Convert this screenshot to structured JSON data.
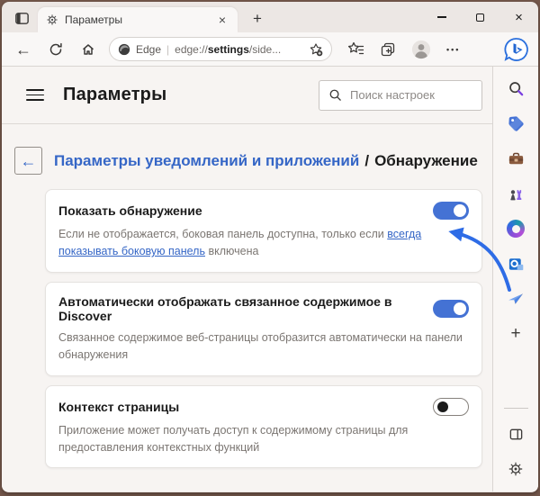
{
  "titlebar": {
    "tab_title": "Параметры"
  },
  "toolbar": {
    "engine_label": "Edge",
    "url": {
      "prefix": "edge://",
      "highlight": "settings",
      "suffix": "/side..."
    }
  },
  "header": {
    "title": "Параметры",
    "search_placeholder": "Поиск настроек"
  },
  "breadcrumb": {
    "parent": "Параметры уведомлений и приложений",
    "separator": "/",
    "current": "Обнаружение"
  },
  "cards": [
    {
      "title": "Показать обнаружение",
      "toggle_on": true,
      "desc_before": "Если не отображается, боковая панель доступна, только если ",
      "desc_link": "всегда показывать боковую панель",
      "desc_after": " включена"
    },
    {
      "title": "Автоматически отображать связанное содержимое в Discover",
      "toggle_on": true,
      "desc": "Связанное содержимое веб-страницы отобразится автоматически на панели обнаружения"
    },
    {
      "title": "Контекст страницы",
      "toggle_on": false,
      "desc": "Приложение может получать доступ к содержимому страницы для предоставления контекстных функций"
    }
  ],
  "glyphs": {
    "close_tab": "×",
    "close_window": "×",
    "new_tab": "+",
    "back": "←",
    "more": "•••",
    "pipe": "|",
    "breadcrumb_back": "←",
    "sidebar_add": "+",
    "bing_letter": "b"
  },
  "sidebar": {
    "items": [
      "bing-chat",
      "search",
      "shopping",
      "tools",
      "games",
      "microsoft-365",
      "outlook",
      "drop",
      "add"
    ],
    "footer_items": [
      "customize-sidebar",
      "settings"
    ]
  },
  "colors": {
    "toggle_on": "#4472d4",
    "link_blue": "#3566c6",
    "arrow_annotation": "#2e6ce6",
    "frame": "#74574b"
  }
}
